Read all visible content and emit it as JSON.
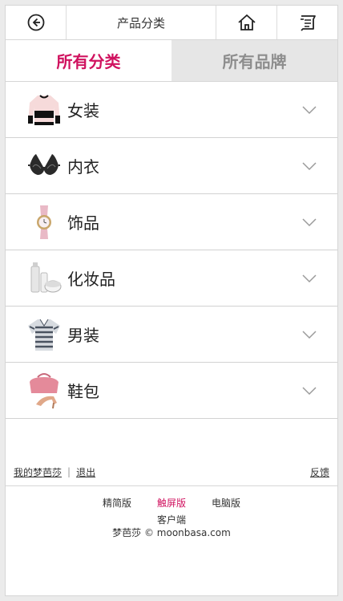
{
  "header": {
    "back_icon": "circle-arrow-left-icon",
    "title": "产品分类",
    "home_icon": "home-icon",
    "list_icon": "list-icon"
  },
  "tabs": [
    {
      "label": "所有分类",
      "active": true
    },
    {
      "label": "所有品牌",
      "active": false
    }
  ],
  "categories": [
    {
      "label": "女装",
      "icon": "sweater-icon"
    },
    {
      "label": "内衣",
      "icon": "bra-icon"
    },
    {
      "label": "饰品",
      "icon": "watch-icon"
    },
    {
      "label": "化妆品",
      "icon": "cosmetics-icon"
    },
    {
      "label": "男装",
      "icon": "polo-shirt-icon"
    },
    {
      "label": "鞋包",
      "icon": "shoes-bag-icon"
    }
  ],
  "footer": {
    "my_account": "我的梦芭莎",
    "logout": "退出",
    "feedback": "反馈",
    "versions": [
      "精简版",
      "触屏版",
      "电脑版"
    ],
    "active_version": "触屏版",
    "client": "客户端",
    "copyright": "梦芭莎 © moonbasa.com"
  },
  "colors": {
    "accent": "#d0125f",
    "inactive_tab_bg": "#e6e6e6"
  }
}
